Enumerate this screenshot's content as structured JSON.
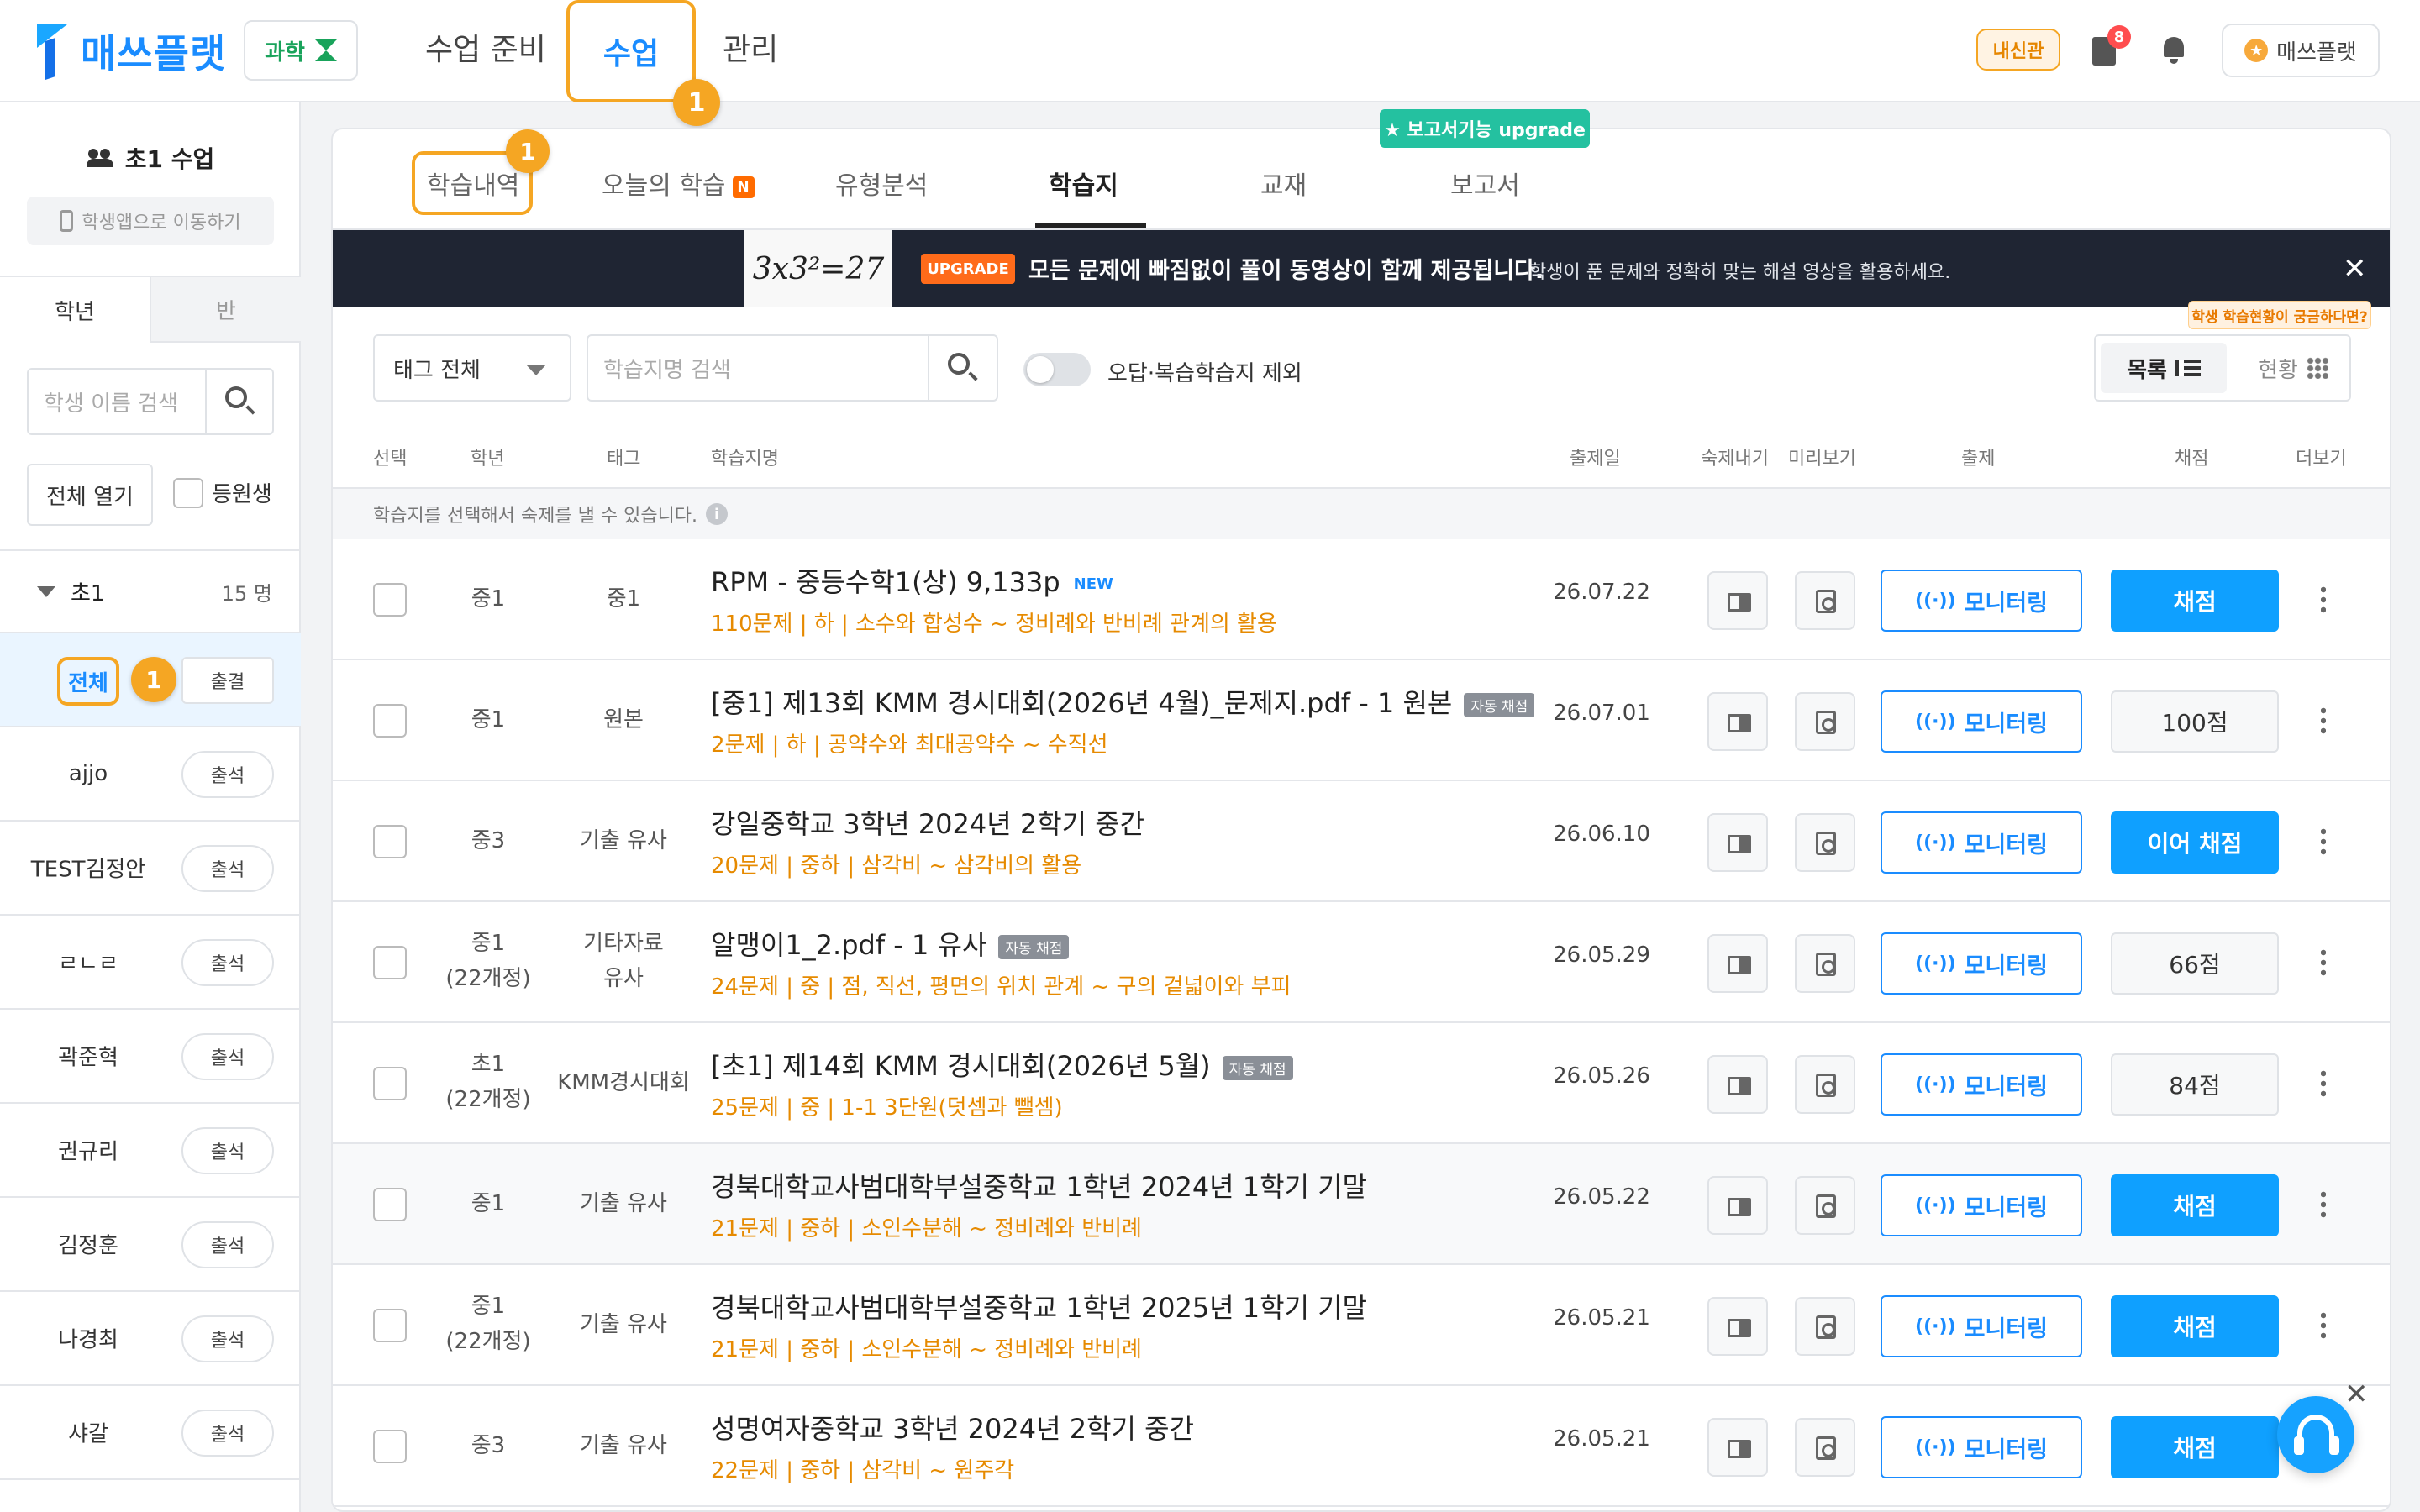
{
  "header": {
    "logo_text": "매쓰플랫",
    "subject": "과학",
    "nav": [
      "수업 준비",
      "수업",
      "관리"
    ],
    "active_nav": "수업",
    "annotation": "1",
    "exam_pill": "내신관",
    "notification_count": "8",
    "account_label": "매쓰플랫",
    "coin_symbol": "★"
  },
  "sidebar": {
    "class_title": "초1 수업",
    "student_app_button": "학생앱으로 이동하기",
    "tabs": [
      "학년",
      "반"
    ],
    "search_placeholder": "학생 이름 검색",
    "open_all": "전체 열기",
    "enrolled_label": "등원생",
    "group": {
      "name": "초1",
      "count": "15 명"
    },
    "all_row": {
      "label": "전체",
      "button": "출결",
      "annotation": "1"
    },
    "students": [
      {
        "name": "ajjo",
        "button": "출석"
      },
      {
        "name": "TEST김정안",
        "button": "출석"
      },
      {
        "name": "ㄹㄴㄹ",
        "button": "출석"
      },
      {
        "name": "곽준혁",
        "button": "출석"
      },
      {
        "name": "권규리",
        "button": "출석"
      },
      {
        "name": "김정훈",
        "button": "출석"
      },
      {
        "name": "나경최",
        "button": "출석"
      },
      {
        "name": "샤갈",
        "button": "출석"
      }
    ]
  },
  "content": {
    "tabs": [
      "학습내역",
      "오늘의 학습",
      "유형분석",
      "학습지",
      "교재",
      "보고서"
    ],
    "today_badge": "N",
    "active_tab": "학습지",
    "tab_annotation": "1",
    "report_upgrade": "★ 보고서기능 upgrade",
    "banner": {
      "image_text": "3x3²=27",
      "tag": "UPGRADE",
      "main": "모든 문제에 빠짐없이 풀이 동영상이 함께 제공됩니다.",
      "sub": "학생이 푼 문제와 정확히 맞는 해설 영상을 활용하세요.",
      "close": "✕"
    },
    "filters": {
      "tag_select": "태그 전체",
      "search_placeholder": "학습지명 검색",
      "toggle_label": "오답·복습학습지 제외",
      "view_list": "목록",
      "view_status": "현황",
      "tooltip": "학생 학습현황이 궁금하다면?"
    },
    "columns": [
      "선택",
      "학년",
      "태그",
      "학습지명",
      "출제일",
      "숙제내기",
      "미리보기",
      "출제",
      "채점",
      "더보기"
    ],
    "hint": "학습지를 선택해서 숙제를 낼 수 있습니다.",
    "info_icon": "i",
    "monitor_label": "모니터링",
    "signal_symbol": "((·))",
    "rows": [
      {
        "grade": "중1",
        "grade2": "",
        "tag": "중1",
        "tag2": "",
        "title": "RPM - 중등수학1(상) 9,133p",
        "badge": "NEW",
        "auto": "",
        "sub": "110문제 | 하 | 소수와 합성수 ~ 정비례와 반비례 관계의 활용",
        "date": "26.07.22",
        "grade_btn": "채점",
        "grade_type": "primary"
      },
      {
        "grade": "중1",
        "grade2": "",
        "tag": "원본",
        "tag2": "",
        "title": "[중1] 제13회 KMM 경시대회(2026년 4월)_문제지.pdf - 1 원본",
        "badge": "",
        "auto": "자동 채점",
        "sub": "2문제 | 하 | 공약수와 최대공약수 ~ 수직선",
        "date": "26.07.01",
        "grade_btn": "100점",
        "grade_type": "score"
      },
      {
        "grade": "중3",
        "grade2": "",
        "tag": "기출 유사",
        "tag2": "",
        "title": "강일중학교 3학년 2024년 2학기 중간",
        "badge": "",
        "auto": "",
        "sub": "20문제 | 중하 | 삼각비 ~ 삼각비의 활용",
        "date": "26.06.10",
        "grade_btn": "이어 채점",
        "grade_type": "primary"
      },
      {
        "grade": "중1",
        "grade2": "(22개정)",
        "tag": "기타자료",
        "tag2": "유사",
        "title": "알맹이1_2.pdf - 1 유사",
        "badge": "",
        "auto": "자동 채점",
        "sub": "24문제 | 중 | 점, 직선, 평면의 위치 관계 ~ 구의 겉넓이와 부피",
        "date": "26.05.29",
        "grade_btn": "66점",
        "grade_type": "score"
      },
      {
        "grade": "초1",
        "grade2": "(22개정)",
        "tag": "KMM경시대회",
        "tag2": "",
        "title": "[초1] 제14회 KMM 경시대회(2026년 5월)",
        "badge": "",
        "auto": "자동 채점",
        "sub": "25문제 | 중 | 1-1 3단원(덧셈과 뺄셈)",
        "date": "26.05.26",
        "grade_btn": "84점",
        "grade_type": "score"
      },
      {
        "grade": "중1",
        "grade2": "",
        "tag": "기출 유사",
        "tag2": "",
        "title": "경북대학교사범대학부설중학교 1학년 2024년 1학기 기말",
        "badge": "",
        "auto": "",
        "sub": "21문제 | 중하 | 소인수분해 ~ 정비례와 반비례",
        "date": "26.05.22",
        "grade_btn": "채점",
        "grade_type": "primary"
      },
      {
        "grade": "중1",
        "grade2": "(22개정)",
        "tag": "기출 유사",
        "tag2": "",
        "title": "경북대학교사범대학부설중학교 1학년 2025년 1학기 기말",
        "badge": "",
        "auto": "",
        "sub": "21문제 | 중하 | 소인수분해 ~ 정비례와 반비례",
        "date": "26.05.21",
        "grade_btn": "채점",
        "grade_type": "primary"
      },
      {
        "grade": "중3",
        "grade2": "",
        "tag": "기출 유사",
        "tag2": "",
        "title": "성명여자중학교 3학년 2024년 2학기 중간",
        "badge": "",
        "auto": "",
        "sub": "22문제 | 중하 | 삼각비 ~ 원주각",
        "date": "26.05.21",
        "grade_btn": "채점",
        "grade_type": "primary"
      }
    ]
  },
  "floating": {
    "close": "✕"
  }
}
